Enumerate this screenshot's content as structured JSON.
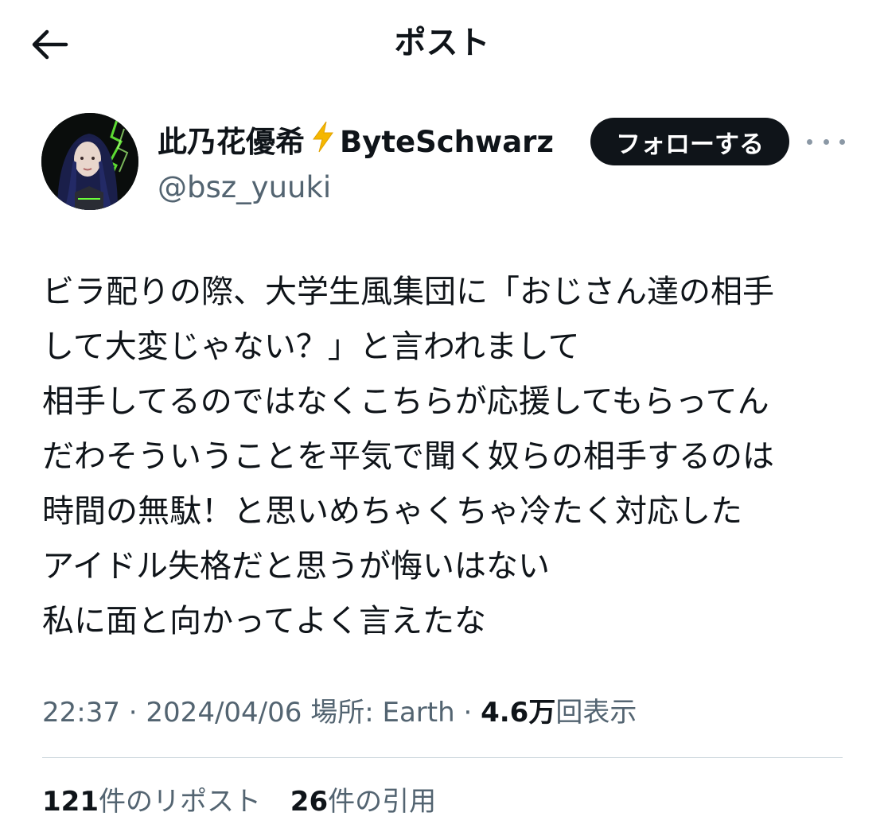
{
  "header": {
    "title": "ポスト",
    "back_icon": "arrow-left-icon"
  },
  "author": {
    "display_name": "此乃花優希",
    "name_emoji_icon": "lightning-bolt-icon",
    "group_name": "ByteSchwarz",
    "handle": "@bsz_yuuki",
    "follow_label": "フォローする",
    "more_icon": "more-options-icon"
  },
  "post": {
    "lines": [
      "ビラ配りの際、大学生風集団に「おじさん達の相手",
      "して大変じゃない？」と言われまして",
      "相手してるのではなくこちらが応援してもらってん",
      "だわそういうことを平気で聞く奴らの相手するのは",
      "時間の無駄！と思いめちゃくちゃ冷たく対応した",
      "アイドル失格だと思うが悔いはない",
      "私に面と向かってよく言えたな"
    ]
  },
  "meta": {
    "time": "22:37",
    "date": "2024/04/06",
    "location_label": "場所: Earth",
    "separator": "·",
    "views_count": "4.6万",
    "views_label": "回表示"
  },
  "stats": {
    "reposts_count": "121",
    "reposts_label": "件のリポスト",
    "quotes_count": "26",
    "quotes_label": "件の引用"
  },
  "colors": {
    "text_primary": "#0f1419",
    "text_secondary": "#536471",
    "follow_button_bg": "#0f1419",
    "bolt": "#f5b700",
    "divider": "#cfd9de"
  }
}
